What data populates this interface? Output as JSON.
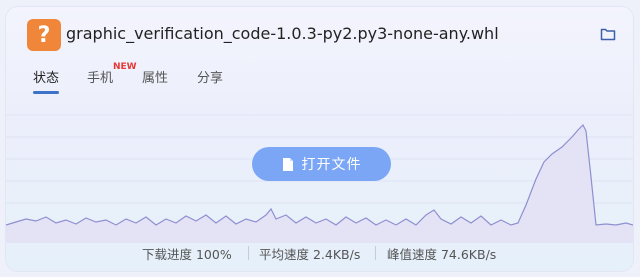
{
  "file": {
    "icon_symbol": "?",
    "icon_color": "#f0863a",
    "name": "graphic_verification_code-1.0.3-py2.py3-none-any.whl",
    "folder_icon": "folder-icon"
  },
  "tabs": [
    {
      "label": "状态",
      "active": true
    },
    {
      "label": "手机",
      "active": false,
      "badge": "NEW"
    },
    {
      "label": "属性",
      "active": false
    },
    {
      "label": "分享",
      "active": false
    }
  ],
  "open_button": {
    "label": "打开文件",
    "icon": "document-icon"
  },
  "stats": {
    "progress": "下载进度 100%",
    "avg_speed": "平均速度 2.4KB/s",
    "peak_speed": "峰值速度 74.6KB/s"
  },
  "colors": {
    "accent": "#3c73c8",
    "button": "#7aa6f5",
    "graph_line": "#8f8fd0",
    "badge": "#e53935"
  }
}
